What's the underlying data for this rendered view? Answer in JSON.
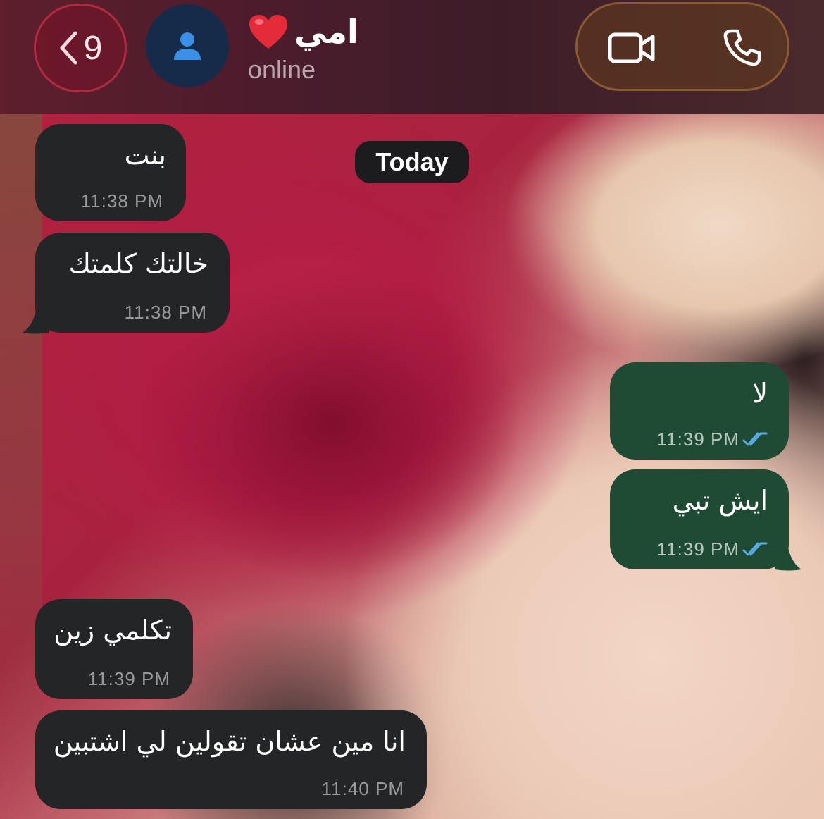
{
  "header": {
    "back_count": "9",
    "contact_name": "امي",
    "status": "online"
  },
  "date_separator": "Today",
  "messages": [
    {
      "direction": "in",
      "text": "بنت",
      "time": "11:38 PM"
    },
    {
      "direction": "in",
      "text": "خالتك كلمتك",
      "time": "11:38 PM"
    },
    {
      "direction": "out",
      "text": "لا",
      "time": "11:39 PM",
      "read": true
    },
    {
      "direction": "out",
      "text": "ايش تبي",
      "time": "11:39 PM",
      "read": true
    },
    {
      "direction": "in",
      "text": "تكلمي زين",
      "time": "11:39 PM"
    },
    {
      "direction": "in",
      "text": "انا مين عشان تقولين لي اشتبين",
      "time": "11:40 PM"
    }
  ],
  "colors": {
    "incoming_bubble": "#242526",
    "outgoing_bubble": "#1f4a34",
    "read_ticks": "#5aaae6",
    "avatar_bg": "#162a4a",
    "avatar_icon": "#3b8fe6"
  },
  "icons": {
    "back": "chevron-left-icon",
    "avatar": "person-icon",
    "heart": "red-heart-emoji",
    "video": "video-camera-icon",
    "phone": "phone-icon",
    "read": "double-check-icon"
  }
}
